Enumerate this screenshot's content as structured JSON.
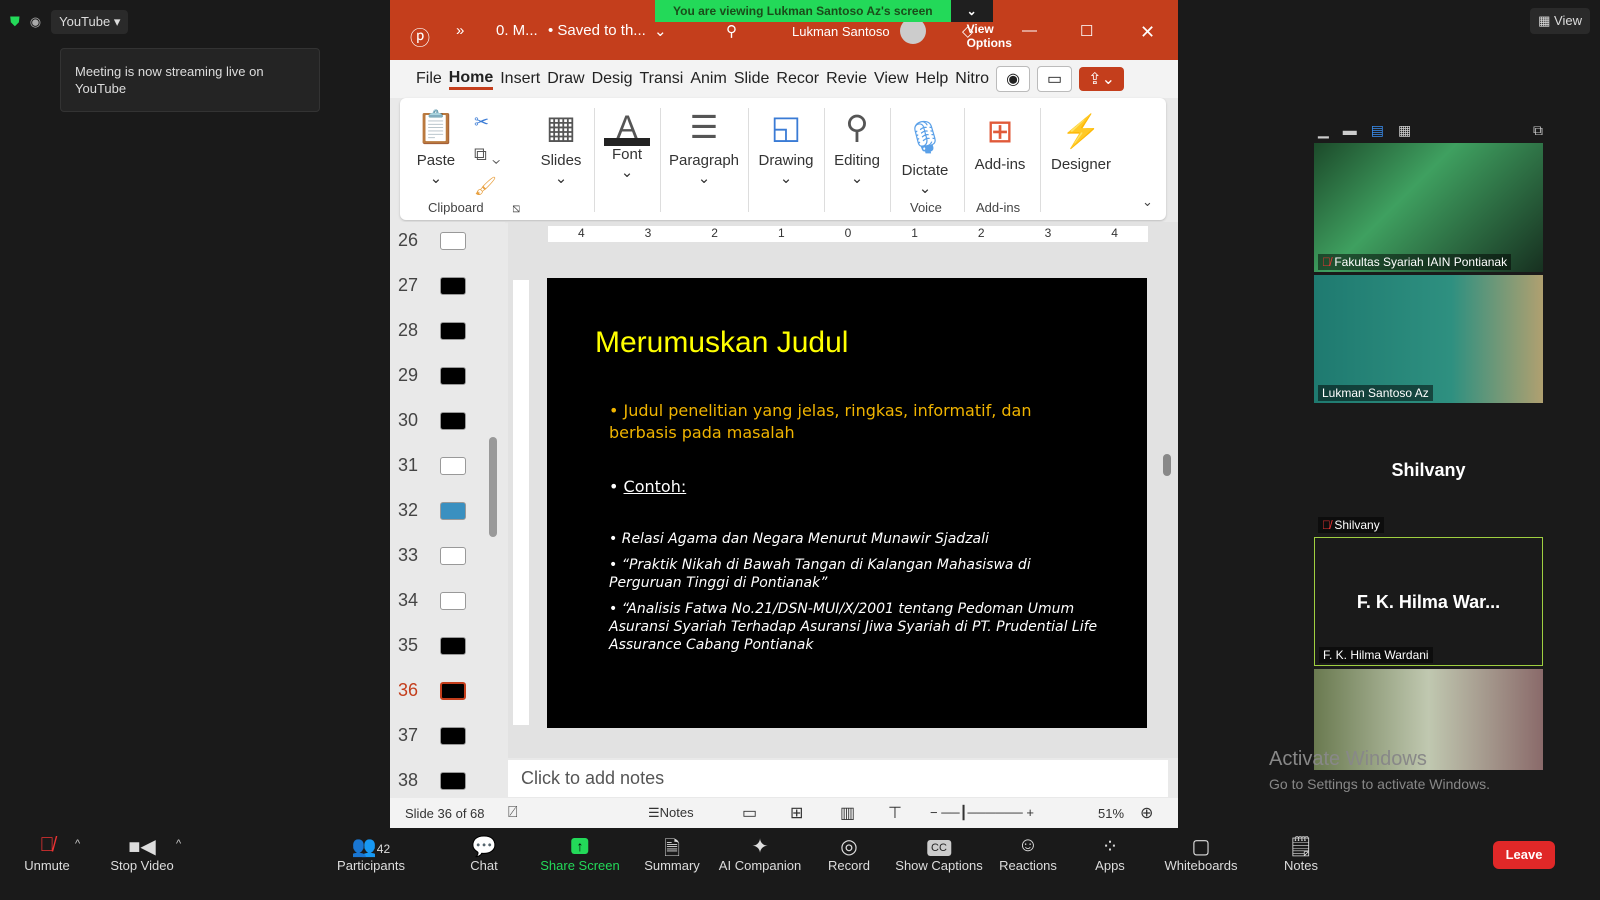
{
  "zoom": {
    "streaming_app": "YouTube",
    "toast": "Meeting is now streaming live on YouTube",
    "view_label": "View",
    "banner": "You are viewing Lukman Santoso Az's screen",
    "view_options": "View Options"
  },
  "ppt": {
    "title": "0. M...",
    "saved": "• Saved to th...",
    "user": "Lukman Santoso",
    "tabs": [
      "File",
      "Home",
      "Insert",
      "Draw",
      "Desig",
      "Transi",
      "Anim",
      "Slide",
      "Recor",
      "Revie",
      "View",
      "Help",
      "Nitro"
    ],
    "ribbon": {
      "paste": "Paste",
      "clipboard": "Clipboard",
      "slides": "Slides",
      "font": "Font",
      "paragraph": "Paragraph",
      "drawing": "Drawing",
      "editing": "Editing",
      "dictate": "Dictate",
      "voice": "Voice",
      "addins": "Add-ins",
      "addins_group": "Add-ins",
      "designer": "Designer"
    },
    "ruler": [
      "4",
      "3",
      "2",
      "1",
      "0",
      "1",
      "2",
      "3",
      "4"
    ],
    "thumbnails": [
      "26",
      "27",
      "28",
      "29",
      "30",
      "31",
      "32",
      "33",
      "34",
      "35",
      "36",
      "37",
      "38"
    ],
    "current_slide": "36",
    "slide": {
      "title": "Merumuskan Judul",
      "bullet1": "Judul penelitian yang jelas, ringkas, informatif, dan berbasis pada masalah",
      "bullet2": "Contoh:",
      "examples": [
        "Relasi Agama dan Negara Menurut Munawir Sjadzali",
        "“Praktik Nikah di Bawah Tangan di Kalangan Mahasiswa di Perguruan Tinggi di Pontianak”",
        "“Analisis Fatwa No.21/DSN-MUI/X/2001 tentang Pedoman Umum Asuransi Syariah Terhadap Asuransi Jiwa Syariah di PT. Prudential Life Assurance Cabang Pontianak"
      ]
    },
    "notes_placeholder": "Click to add notes",
    "status": {
      "slide_count": "Slide 36 of 68",
      "notes": "Notes",
      "zoom": "51%"
    },
    "zoom_level_percent": 51,
    "accent": "#c43e1c"
  },
  "participants": [
    {
      "name": "Fakultas Syariah IAIN Pontianak",
      "muted": true
    },
    {
      "name": "Lukman Santoso Az",
      "muted": false
    },
    {
      "name": "Shilvany",
      "big": "Shilvany",
      "muted": true
    },
    {
      "name": "F. K. Hilma Wardani",
      "big": "F. K. Hilma War...",
      "muted": false
    },
    {
      "name": "",
      "muted": false
    }
  ],
  "windows_watermark": {
    "line1": "Activate Windows",
    "line2": "Go to Settings to activate Windows."
  },
  "toolbar": {
    "unmute": "Unmute",
    "stop_video": "Stop Video",
    "participants": "Participants",
    "participants_count": "42",
    "chat": "Chat",
    "share": "Share Screen",
    "summary": "Summary",
    "ai": "AI Companion",
    "record": "Record",
    "captions": "Show Captions",
    "reactions": "Reactions",
    "apps": "Apps",
    "whiteboards": "Whiteboards",
    "notes": "Notes",
    "leave": "Leave"
  }
}
